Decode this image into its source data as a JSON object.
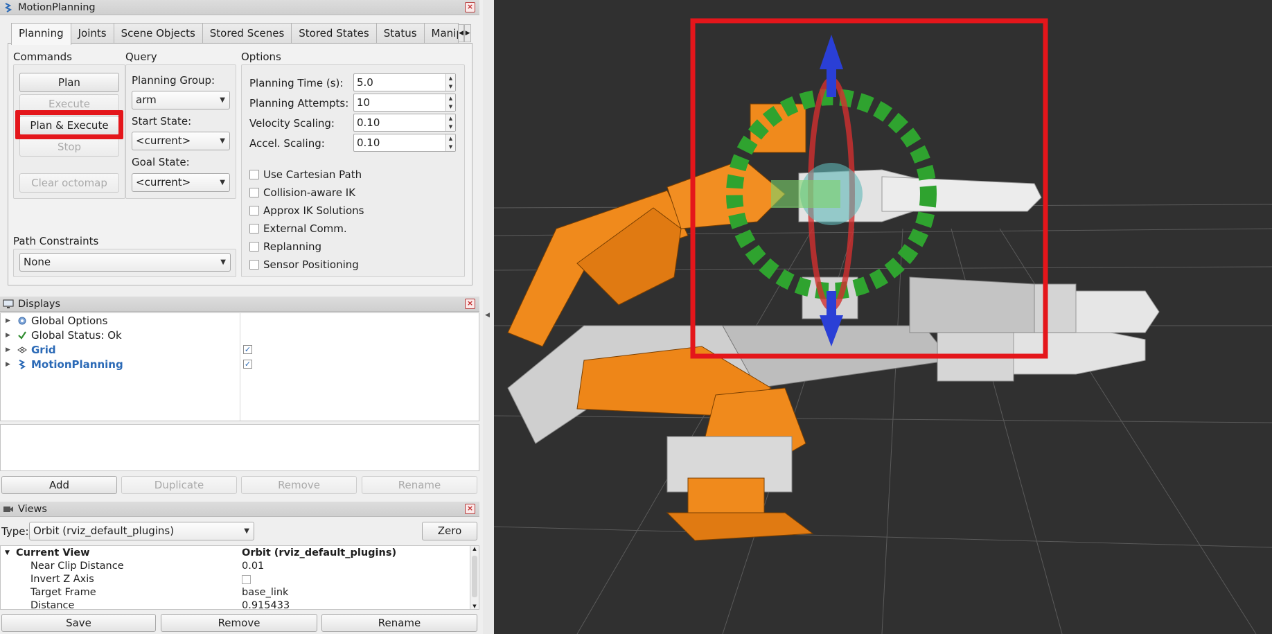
{
  "motion_planning": {
    "title": "MotionPlanning",
    "tabs": [
      "Planning",
      "Joints",
      "Scene Objects",
      "Stored Scenes",
      "Stored States",
      "Status",
      "Manipul"
    ],
    "commands": {
      "label": "Commands",
      "plan": "Plan",
      "execute": "Execute",
      "plan_execute": "Plan & Execute",
      "stop": "Stop",
      "clear_octomap": "Clear octomap"
    },
    "query": {
      "label": "Query",
      "planning_group_label": "Planning Group:",
      "planning_group_value": "arm",
      "start_state_label": "Start State:",
      "start_state_value": "<current>",
      "goal_state_label": "Goal State:",
      "goal_state_value": "<current>"
    },
    "options": {
      "label": "Options",
      "planning_time_label": "Planning Time (s):",
      "planning_time_value": "5.0",
      "planning_attempts_label": "Planning Attempts:",
      "planning_attempts_value": "10",
      "velocity_scaling_label": "Velocity Scaling:",
      "velocity_scaling_value": "0.10",
      "accel_scaling_label": "Accel. Scaling:",
      "accel_scaling_value": "0.10",
      "checkboxes": [
        "Use Cartesian Path",
        "Collision-aware IK",
        "Approx IK Solutions",
        "External Comm.",
        "Replanning",
        "Sensor Positioning"
      ]
    },
    "path_constraints": {
      "label": "Path Constraints",
      "value": "None"
    }
  },
  "displays": {
    "title": "Displays",
    "items": [
      {
        "label": "Global Options"
      },
      {
        "label": "Global Status: Ok"
      },
      {
        "label": "Grid",
        "checked": true
      },
      {
        "label": "MotionPlanning",
        "checked": true
      }
    ],
    "buttons": {
      "add": "Add",
      "duplicate": "Duplicate",
      "remove": "Remove",
      "rename": "Rename"
    }
  },
  "views": {
    "title": "Views",
    "type_label": "Type:",
    "type_value": "Orbit (rviz_default_plugins)",
    "zero": "Zero",
    "current_view_label": "Current View",
    "current_view_value": "Orbit (rviz_default_plugins)",
    "properties": [
      {
        "key": "Near Clip Distance",
        "value": "0.01"
      },
      {
        "key": "Invert Z Axis",
        "value": ""
      },
      {
        "key": "Target Frame",
        "value": "base_link"
      },
      {
        "key": "Distance",
        "value": "0.915433"
      }
    ],
    "buttons": {
      "save": "Save",
      "remove": "Remove",
      "rename": "Rename"
    }
  },
  "colors": {
    "highlight": "#e4161b",
    "robot_orange": "#f08a1c",
    "robot_grey": "#c9c9c9",
    "viewport_bg": "#303030"
  }
}
